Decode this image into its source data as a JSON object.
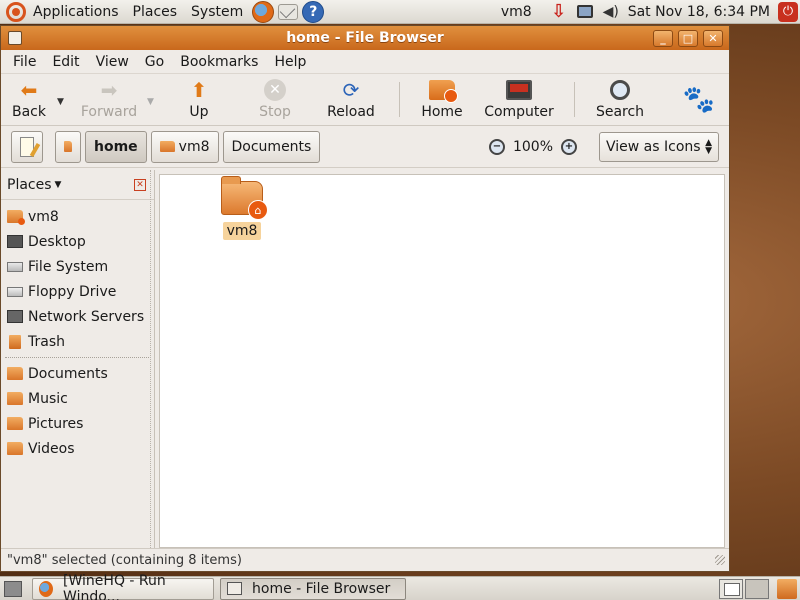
{
  "top_panel": {
    "menus": [
      "Applications",
      "Places",
      "System"
    ],
    "user": "vm8",
    "clock": "Sat Nov 18,  6:34 PM"
  },
  "window": {
    "title": "home - File Browser",
    "menu": [
      "File",
      "Edit",
      "View",
      "Go",
      "Bookmarks",
      "Help"
    ],
    "toolbar": {
      "back": "Back",
      "forward": "Forward",
      "up": "Up",
      "stop": "Stop",
      "reload": "Reload",
      "home": "Home",
      "computer": "Computer",
      "search": "Search"
    },
    "location": {
      "crumbs": [
        "home",
        "vm8",
        "Documents"
      ],
      "zoom": "100%",
      "view_mode": "View as Icons"
    },
    "sidebar": {
      "header": "Places",
      "items": [
        {
          "label": "vm8",
          "icon": "home-folder-icon"
        },
        {
          "label": "Desktop",
          "icon": "desktop-icon"
        },
        {
          "label": "File System",
          "icon": "filesystem-icon"
        },
        {
          "label": "Floppy Drive",
          "icon": "floppy-icon"
        },
        {
          "label": "Network Servers",
          "icon": "network-icon"
        },
        {
          "label": "Trash",
          "icon": "trash-icon"
        }
      ],
      "bookmarks": [
        {
          "label": "Documents",
          "icon": "folder-icon"
        },
        {
          "label": "Music",
          "icon": "folder-icon"
        },
        {
          "label": "Pictures",
          "icon": "folder-icon"
        },
        {
          "label": "Videos",
          "icon": "folder-icon"
        }
      ]
    },
    "files": [
      {
        "name": "vm8",
        "selected": true
      }
    ],
    "status": "\"vm8\" selected (containing 8 items)"
  },
  "taskbar": {
    "tasks": [
      "[WineHQ - Run Windo...",
      "home - File Browser"
    ]
  },
  "colors": {
    "accent": "#d9762a",
    "titlebar": "#c9681c",
    "selection": "#f6d39c"
  }
}
